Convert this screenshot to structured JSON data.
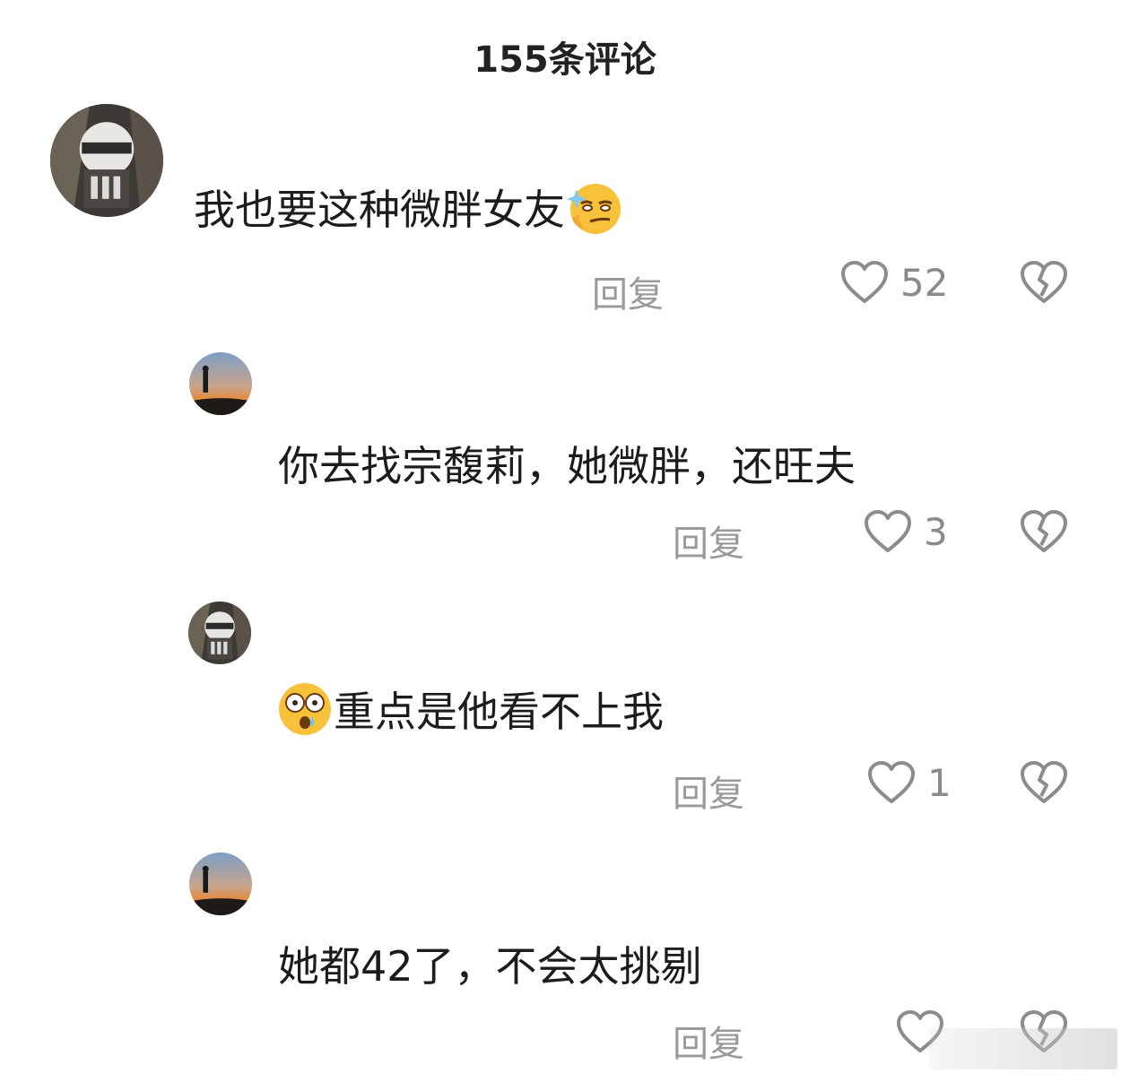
{
  "header": {
    "title": "155条评论"
  },
  "comments": [
    {
      "text": "我也要这种微胖女友",
      "emoji": "smirk-sparkle-emoji",
      "reply_label": "回复",
      "likes": "52"
    },
    {
      "text": "你去找宗馥莉，她微胖，还旺夫",
      "reply_label": "回复",
      "likes": "3"
    },
    {
      "text": "重点是他看不上我",
      "emoji": "shocked-emoji",
      "reply_label": "回复",
      "likes": "1"
    },
    {
      "text": "她都42了，不会太挑剔",
      "reply_label": "回复",
      "likes": ""
    }
  ],
  "colors": {
    "icon_gray": "#8c8c8c",
    "text": "#1c1c1c",
    "muted": "#9a9a9a"
  }
}
